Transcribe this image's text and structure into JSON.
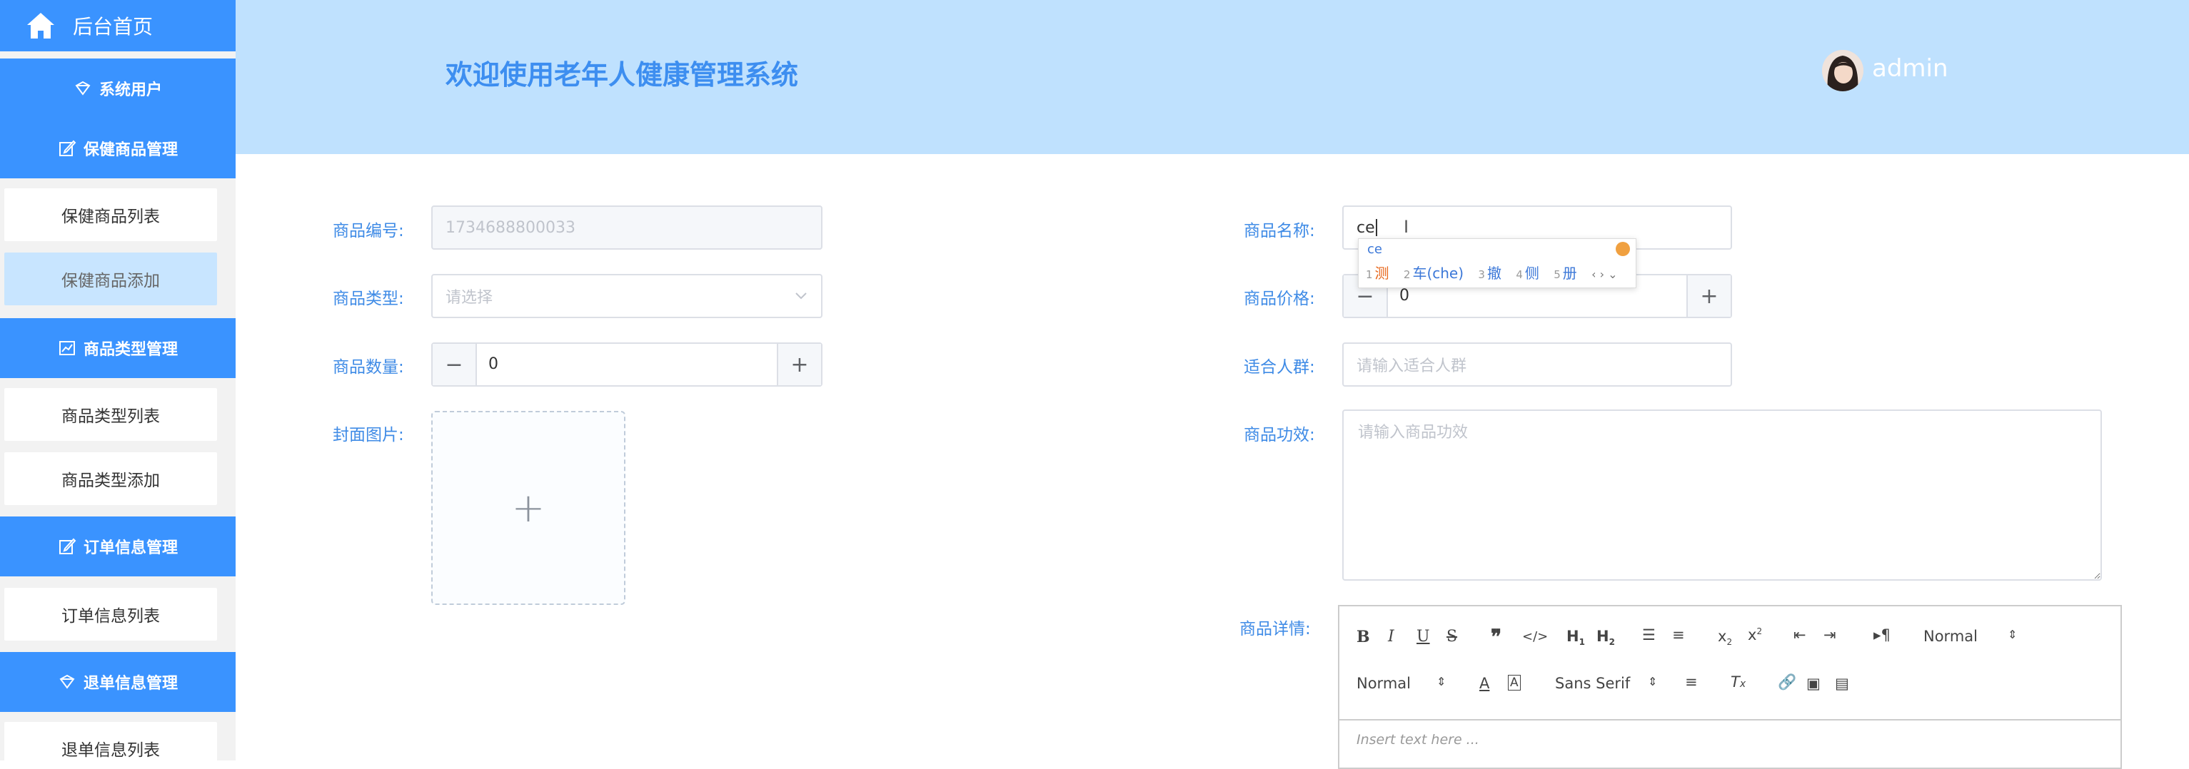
{
  "sidebar": {
    "home_label": "后台首页",
    "groups": {
      "system_users": "系统用户",
      "product_mgmt": "保健商品管理",
      "type_mgmt": "商品类型管理",
      "order_mgmt": "订单信息管理",
      "refund_mgmt": "退单信息管理"
    },
    "items": {
      "product_list": "保健商品列表",
      "product_add": "保健商品添加",
      "type_list": "商品类型列表",
      "type_add": "商品类型添加",
      "order_list": "订单信息列表",
      "refund_list": "退单信息列表"
    },
    "colors": {
      "primary": "#3a93ff",
      "active_item": "#c8e5ff"
    }
  },
  "header": {
    "title": "欢迎使用老年人健康管理系统",
    "username": "admin",
    "background": "#bfe1fe"
  },
  "form": {
    "code": {
      "label": "商品编号:",
      "value": "1734688800033"
    },
    "type": {
      "label": "商品类型:",
      "placeholder": "请选择"
    },
    "quantity": {
      "label": "商品数量:",
      "value": "0",
      "minus": "−",
      "plus": "+"
    },
    "cover": {
      "label": "封面图片:",
      "plus": "+"
    },
    "name": {
      "label": "商品名称:",
      "value": "ce"
    },
    "price": {
      "label": "商品价格:",
      "value": "0",
      "minus": "−",
      "plus": "+"
    },
    "audience": {
      "label": "适合人群:",
      "placeholder": "请输入适合人群"
    },
    "effect": {
      "label": "商品功效:",
      "placeholder": "请输入商品功效"
    },
    "detail": {
      "label": "商品详情:"
    }
  },
  "ime": {
    "pinyin": "ce",
    "candidates": [
      {
        "num": "1",
        "text": "测"
      },
      {
        "num": "2",
        "text": "车(che)"
      },
      {
        "num": "3",
        "text": "撤"
      },
      {
        "num": "4",
        "text": "侧"
      },
      {
        "num": "5",
        "text": "册"
      }
    ],
    "nav": "‹ › ⌄"
  },
  "editor": {
    "header_select": "Normal",
    "size_select": "Normal",
    "font_select": "Sans Serif",
    "placeholder": "Insert text here ..."
  }
}
